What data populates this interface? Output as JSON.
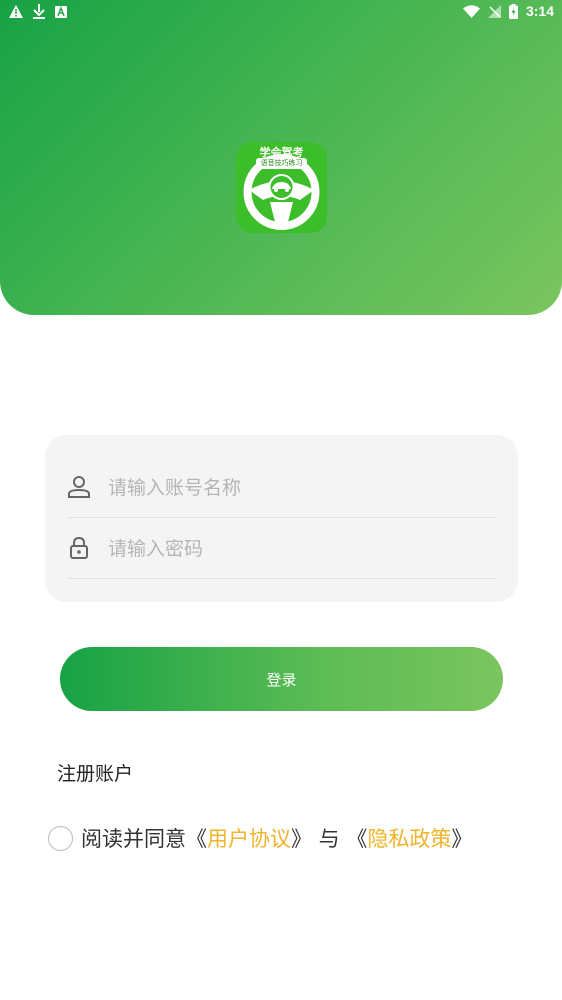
{
  "status_bar": {
    "time": "3:14",
    "left_icons": [
      "warning-icon",
      "download-icon",
      "app-notification-icon"
    ],
    "right_icons": [
      "wifi-icon",
      "no-signal-icon",
      "battery-icon"
    ]
  },
  "logo": {
    "title": "学会驾考",
    "subtitle": "语音技巧练习"
  },
  "form": {
    "username_placeholder": "请输入账号名称",
    "password_placeholder": "请输入密码"
  },
  "login_button": "登录",
  "register_link": "注册账户",
  "agreement": {
    "prefix": "阅读并同意",
    "open_bracket": "《",
    "close_bracket": "》",
    "user_agreement": "用户协议",
    "connector": " 与 ",
    "privacy_policy": "隐私政策"
  },
  "colors": {
    "primary_green": "#17a245",
    "light_green": "#7bc55f",
    "link_orange": "#f0b32a"
  }
}
